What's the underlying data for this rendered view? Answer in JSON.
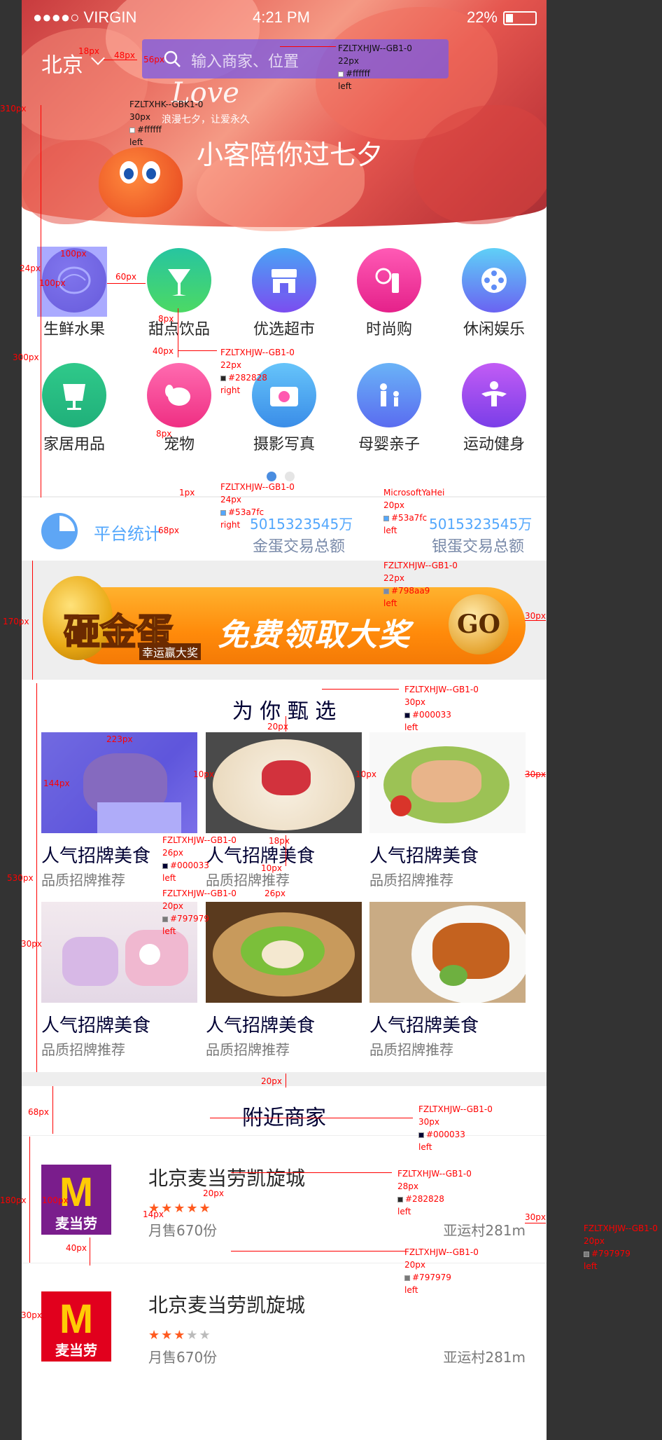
{
  "status_bar": {
    "carrier": "●●●●○ VIRGIN",
    "time": "4:21 PM",
    "battery": "22%"
  },
  "header": {
    "city": "北京",
    "search_placeholder": "输入商家、位置"
  },
  "banner": {
    "love_text": "Love",
    "sub_text": "浪漫七夕，让爱永久",
    "slogan": "小客陪你过七夕"
  },
  "categories": [
    {
      "label": "生鲜水果",
      "icon": "fruit-icon",
      "color": "#7a5fbf"
    },
    {
      "label": "甜点饮品",
      "icon": "drink-icon",
      "color": "#3ecf6e"
    },
    {
      "label": "优选超市",
      "icon": "store-icon",
      "color": "#6a63f2"
    },
    {
      "label": "时尚购",
      "icon": "lipstick-icon",
      "color": "#f03a9a"
    },
    {
      "label": "休闲娱乐",
      "icon": "film-reel-icon",
      "color": "#5f8df6"
    },
    {
      "label": "家居用品",
      "icon": "lamp-icon",
      "color": "#2fc98a"
    },
    {
      "label": "宠物",
      "icon": "dog-icon",
      "color": "#f44d96"
    },
    {
      "label": "摄影写真",
      "icon": "camera-icon",
      "color": "#5ab0f7"
    },
    {
      "label": "母婴亲子",
      "icon": "parent-child-icon",
      "color": "#5a8cf2"
    },
    {
      "label": "运动健身",
      "icon": "fitness-icon",
      "color": "#9a4df0"
    }
  ],
  "stats": {
    "title": "平台统计",
    "items": [
      {
        "value": "5015323545万",
        "label": "金蛋交易总额"
      },
      {
        "value": "5015323545万",
        "label": "银蛋交易总额"
      }
    ]
  },
  "promo": {
    "egg_title": "砸金蛋",
    "egg_sub": "幸运赢大奖",
    "text": "免费领取大奖",
    "go": "GO"
  },
  "picks": {
    "title": "为 你 甄 选",
    "items": [
      {
        "title": "人气招牌美食",
        "subtitle": "品质招牌推荐"
      },
      {
        "title": "人气招牌美食",
        "subtitle": "品质招牌推荐"
      },
      {
        "title": "人气招牌美食",
        "subtitle": "品质招牌推荐"
      },
      {
        "title": "人气招牌美食",
        "subtitle": "品质招牌推荐"
      },
      {
        "title": "人气招牌美食",
        "subtitle": "品质招牌推荐"
      },
      {
        "title": "人气招牌美食",
        "subtitle": "品质招牌推荐"
      }
    ]
  },
  "nearby": {
    "title": "附近商家",
    "merchants": [
      {
        "name": "北京麦当劳凯旋城",
        "rating": 5,
        "sales": "月售670份",
        "location": "亚运村281m",
        "logo_text": "麦当劳"
      },
      {
        "name": "北京麦当劳凯旋城",
        "rating": 3,
        "sales": "月售670份",
        "location": "亚运村281m",
        "logo_text": "麦当劳"
      }
    ]
  },
  "annotations": {
    "d48": "48px",
    "d18": "18px",
    "d56": "56px",
    "d310": "310px",
    "d24": "24px",
    "d100a": "100px",
    "d100b": "100px",
    "d60": "60px",
    "d8a": "8px",
    "d40": "40px",
    "d8b": "8px",
    "d300": "300px",
    "d1": "1px",
    "d68a": "68px",
    "d170": "170px",
    "d30a": "30px",
    "d223": "223px",
    "d144": "144px",
    "d10a": "10px",
    "d10b": "10px",
    "d30b": "30px",
    "d20a": "20px",
    "d18b": "18px",
    "d10c": "10px",
    "d26": "26px",
    "d530": "530px",
    "d30c": "30px",
    "d20b": "20px",
    "d68b": "68px",
    "d180": "180px",
    "d100c": "100px",
    "d20c": "20px",
    "d14": "14px",
    "d40b": "40px",
    "d30d": "30px",
    "d30e": "30px",
    "search_spec": [
      "FZLTXHJW--GB1-0",
      "22px",
      "#ffffff",
      "left"
    ],
    "city_spec": [
      "FZLTXHK--GBK1-0",
      "30px",
      "#ffffff",
      "left"
    ],
    "cat_spec": [
      "FZLTXHJW--GB1-0",
      "22px",
      "#282828",
      "right"
    ],
    "stat_title_spec": [
      "FZLTXHJW--GB1-0",
      "24px",
      "#53a7fc",
      "right"
    ],
    "stat_value_spec": [
      "MicrosoftYaHei",
      "20px",
      "#53a7fc",
      "left"
    ],
    "stat_label_spec": [
      "FZLTXHJW--GB1-0",
      "22px",
      "#798aa9",
      "left"
    ],
    "picks_title_spec": [
      "FZLTXHJW--GB1-0",
      "30px",
      "#000033",
      "left"
    ],
    "card_title_spec": [
      "FZLTXHJW--GB1-0",
      "26px",
      "#000033",
      "left"
    ],
    "card_sub_spec": [
      "FZLTXHJW--GB1-0",
      "20px",
      "#797979",
      "left"
    ],
    "nearby_title_spec": [
      "FZLTXHJW--GB1-0",
      "30px",
      "#000033",
      "left"
    ],
    "merch_name_spec": [
      "FZLTXHJW--GB1-0",
      "28px",
      "#282828",
      "left"
    ],
    "merch_sales_spec": [
      "FZLTXHJW--GB1-0",
      "20px",
      "#797979",
      "left"
    ],
    "merch_loc_spec": [
      "FZLTXHJW--GB1-0",
      "20px",
      "#797979",
      "left"
    ]
  }
}
